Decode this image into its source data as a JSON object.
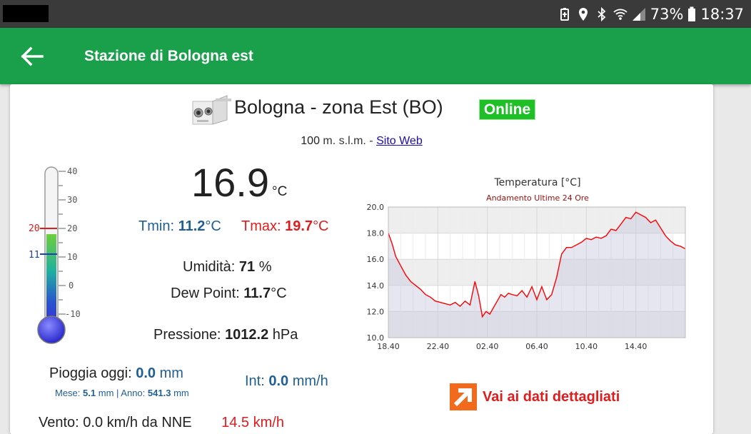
{
  "status_bar": {
    "battery": "73%",
    "time": "18:37"
  },
  "app_bar": {
    "title": "Stazione di Bologna est"
  },
  "station": {
    "name": "Bologna - zona Est (BO)",
    "status": "Online",
    "altitude_value": "100",
    "altitude_unit": "m. s.l.m. -",
    "website_label": "Sito Web"
  },
  "thermometer": {
    "scale": [
      "40",
      "30",
      "20",
      "10",
      "0",
      "-10"
    ],
    "max_marker": "20",
    "min_marker": "11",
    "colors": {
      "max": "#e21c1c",
      "min": "#1f3fb0"
    }
  },
  "temperature": {
    "value": "16.9",
    "unit": "°C",
    "tmin_label": "Tmin:",
    "tmin_value": "11.2",
    "tmin_unit": "°C",
    "tmax_label": "Tmax:",
    "tmax_value": "19.7",
    "tmax_unit": "°C"
  },
  "humidity": {
    "label": "Umidità:",
    "value": "71",
    "unit": "%"
  },
  "dew_point": {
    "label": "Dew Point:",
    "value": "11.7",
    "unit": "°C"
  },
  "pressure": {
    "label": "Pressione:",
    "value": "1012.2",
    "unit": "hPa"
  },
  "rain": {
    "label": "Pioggia oggi:",
    "value": "0.0",
    "unit": "mm",
    "month_label": "Mese:",
    "month_value": "5.1",
    "month_unit": "mm |",
    "year_label": "Anno:",
    "year_value": "541.3",
    "year_unit": "mm",
    "int_label": "Int:",
    "int_value": "0.0",
    "int_unit": "mm/h"
  },
  "wind": {
    "text": "Vento: 0.0 km/h da NNE",
    "gust": "14.5 km/h"
  },
  "detail_link": {
    "label": "Vai ai dati dettagliati"
  },
  "colors": {
    "accent": "#1a9f4b",
    "online": "#1fbf28",
    "blue_text": "#1f5f96",
    "red_text": "#e21c1c"
  },
  "chart_data": {
    "type": "line",
    "title": "Temperatura [°C]",
    "subtitle": "Andamento Ultime 24 Ore",
    "x_ticks": [
      "18.40",
      "22.40",
      "02.40",
      "06.40",
      "10.40",
      "14.40"
    ],
    "y_ticks": [
      "10.0",
      "12.0",
      "14.0",
      "16.0",
      "18.0",
      "20.0"
    ],
    "ylim": [
      10,
      20
    ],
    "xlim": [
      0,
      24
    ],
    "grid": true,
    "series": [
      {
        "color": "#ff0000",
        "x": [
          0,
          0.3,
          0.6,
          1.0,
          1.4,
          1.8,
          2.2,
          2.6,
          3.0,
          3.4,
          3.8,
          4.2,
          4.6,
          5.0,
          5.4,
          5.8,
          6.2,
          6.6,
          7.0,
          7.3,
          7.6,
          7.9,
          8.2,
          8.5,
          8.8,
          9.1,
          9.4,
          9.7,
          10.0,
          10.4,
          10.8,
          11.2,
          11.6,
          12.0,
          12.4,
          12.8,
          13.2,
          13.6,
          14.0,
          14.4,
          14.8,
          15.2,
          15.6,
          16.0,
          16.4,
          16.8,
          17.2,
          17.6,
          18.0,
          18.4,
          18.8,
          19.2,
          19.6,
          20.0,
          20.4,
          20.8,
          21.2,
          21.6,
          22.0,
          22.4,
          22.8,
          23.2,
          23.6,
          24.0
        ],
        "y": [
          18.0,
          17.2,
          16.2,
          15.5,
          14.8,
          14.3,
          14.0,
          13.7,
          13.3,
          13.1,
          12.8,
          12.7,
          12.6,
          12.5,
          12.7,
          12.4,
          12.8,
          12.5,
          14.3,
          13.2,
          11.6,
          12.0,
          11.8,
          12.3,
          12.8,
          13.3,
          13.1,
          13.4,
          13.3,
          13.2,
          13.6,
          13.1,
          13.9,
          12.9,
          13.9,
          12.9,
          13.3,
          14.6,
          16.4,
          16.9,
          16.9,
          17.1,
          17.3,
          17.6,
          17.5,
          17.7,
          17.6,
          17.8,
          18.3,
          18.2,
          18.7,
          19.2,
          19.1,
          19.6,
          19.4,
          19.2,
          18.8,
          19.0,
          18.4,
          17.8,
          17.4,
          17.1,
          17.0,
          16.8
        ]
      }
    ]
  }
}
